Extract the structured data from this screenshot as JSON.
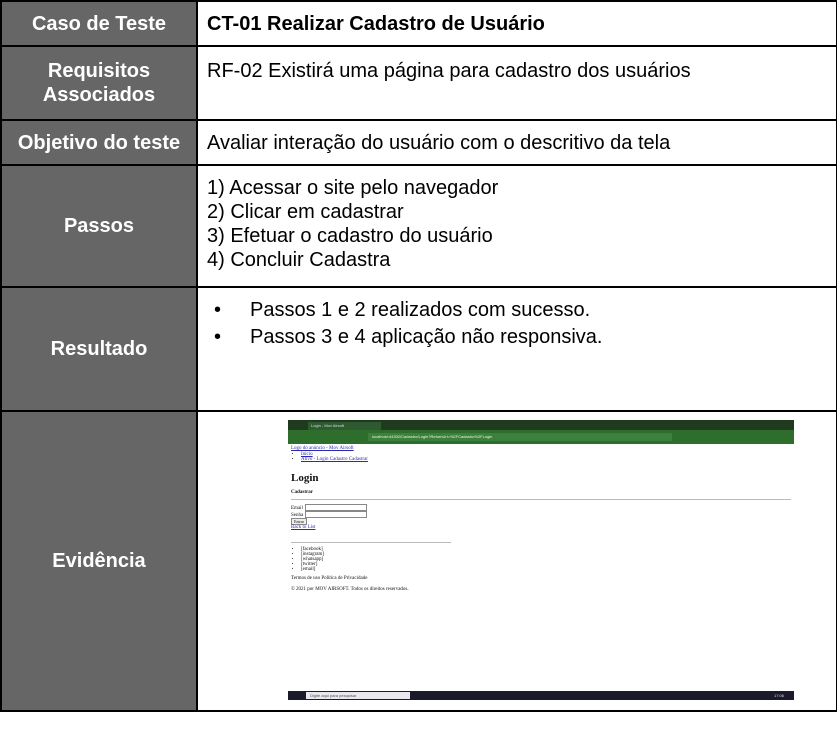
{
  "rows": {
    "case": {
      "label": "Caso de Teste",
      "value": "CT-01 Realizar Cadastro de Usuário"
    },
    "requirements": {
      "label_line1": "Requisitos",
      "label_line2": "Associados",
      "value": "RF-02 Existirá uma página para cadastro dos usuários"
    },
    "objective": {
      "label": "Objetivo do teste",
      "value": "Avaliar interação do usuário com o descritivo da tela"
    },
    "steps": {
      "label": "Passos",
      "items": [
        "1) Acessar o site pelo navegador",
        "2) Clicar em cadastrar",
        "3) Efetuar o cadastro do usuário",
        "4) Concluir Cadastra"
      ]
    },
    "result": {
      "label": "Resultado",
      "items": [
        "Passos 1 e 2 realizados com sucesso.",
        "Passos 3 e 4 aplicação não responsiva."
      ]
    },
    "evidence": {
      "label": "Evidência"
    }
  },
  "screenshot": {
    "tab_title": "Login - Mov Airsoft",
    "url": "localhost:44302/Cadastro/Login?ReturnUrl=%2FCadastro%2FLogin",
    "logo_alt": "Logo do anúncio - Mov Airsoft",
    "nav_items": [
      "Início",
      "Ativo - Login Cadastro Cadastrar"
    ],
    "heading": "Login",
    "cadastrar": "Cadastrar",
    "email_label": "Email",
    "senha_label": "Senha",
    "enter_button": "Entrar",
    "back_link": "Back to List",
    "social_items": [
      "[facebook]",
      "[instagram]",
      "[whatsapp]",
      "[twitter]",
      "[email]"
    ],
    "terms": "Termos de uso Política de Privacidade",
    "copyright": "© 2021 por MOV AIRSOFT. Todos os direitos reservados.",
    "search_placeholder": "Digite aqui para pesquisar",
    "clock": "17:06"
  }
}
